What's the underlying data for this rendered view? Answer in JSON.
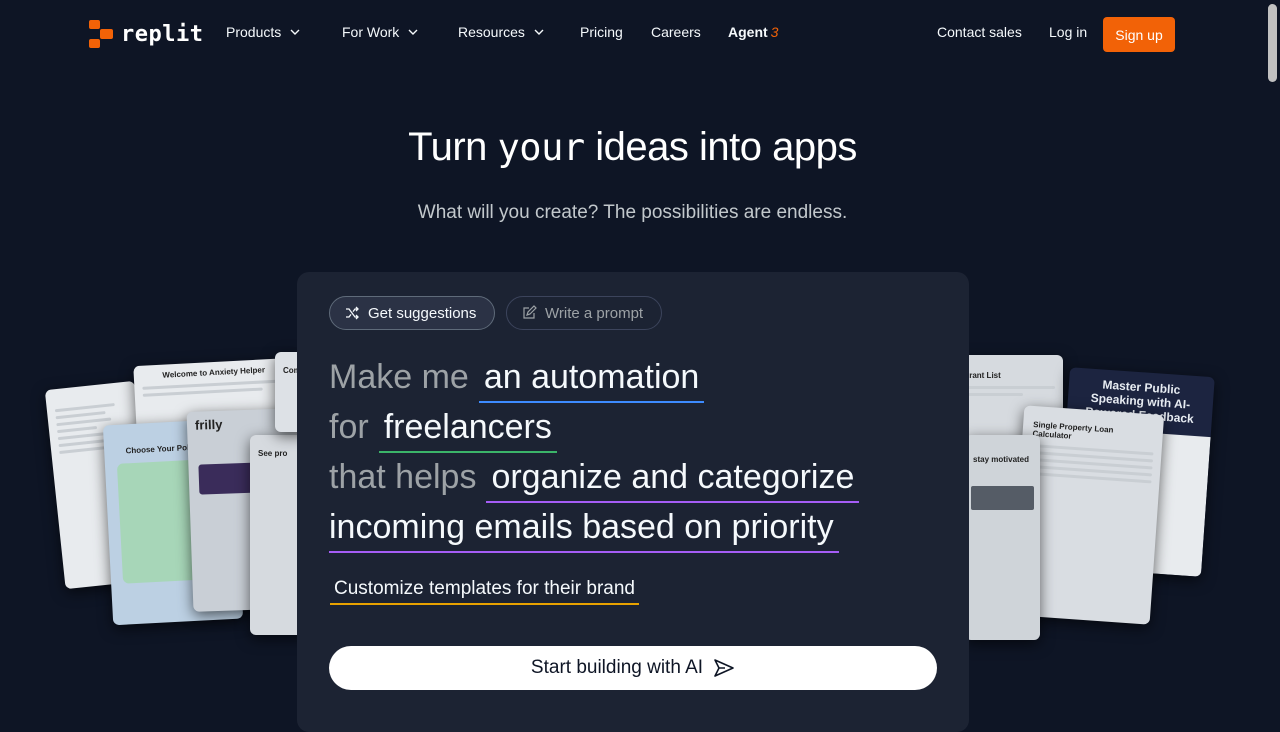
{
  "nav": {
    "logo_text": "replit",
    "products": "Products",
    "for_work": "For Work",
    "resources": "Resources",
    "pricing": "Pricing",
    "careers": "Careers",
    "agent": "Agent",
    "agent_version": "3",
    "contact_sales": "Contact sales",
    "log_in": "Log in",
    "sign_up": "Sign up"
  },
  "hero": {
    "title_part1": "Turn ",
    "title_pixel": "your",
    "title_part2": " ideas into apps",
    "subtitle": "What will you create? The possibilities are endless."
  },
  "panel": {
    "get_suggestions": "Get suggestions",
    "write_prompt": "Write a prompt",
    "line1_prefix": "Make me",
    "line1_token": "an automation",
    "line2_prefix": "for",
    "line2_token": "freelancers",
    "line3_prefix": "that helps",
    "line3_token": "organize and categorize",
    "line4_token": "incoming emails based on priority",
    "customize": "Customize templates for their brand",
    "start_button": "Start building with AI"
  },
  "showcase": {
    "left_cards": [
      "Welcome to Anxiety Helper",
      "Choose Your Pokémon",
      "frilly",
      "See pro",
      "Comp"
    ],
    "right_cards": [
      "Grant List",
      "Master Public Speaking with AI-Powered Feedback",
      "Single Property Loan Calculator",
      "stay motivated"
    ]
  },
  "colors": {
    "background": "#0e1525",
    "panel": "#1c2333",
    "accent": "#f26207",
    "token_blue": "#3d8bff",
    "token_green": "#3bb469",
    "token_purple": "#a55df6",
    "token_yellow": "#e8a200"
  }
}
